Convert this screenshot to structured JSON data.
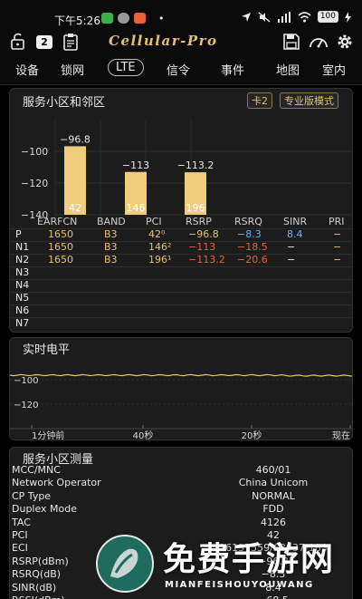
{
  "status_bar": {
    "time": "下午5:26",
    "dot": "•",
    "battery": "100"
  },
  "toolbar": {
    "badge": "2",
    "logo": "Cellular-Pro"
  },
  "tabs": [
    {
      "label": "设备"
    },
    {
      "label": "锁网"
    },
    {
      "label": "LTE"
    },
    {
      "label": "信令"
    },
    {
      "label": "事件"
    },
    {
      "label": "地图"
    },
    {
      "label": "室内"
    }
  ],
  "serving_panel": {
    "title": "服务小区和邻区",
    "card_tag": "卡2",
    "mode_tag": "专业版模式"
  },
  "chart_data": {
    "type": "bar",
    "categories": [
      "42",
      "146",
      "196"
    ],
    "values": [
      -96.8,
      -113,
      -113.2
    ],
    "value_labels": [
      "−96.8",
      "−113",
      "−113.2"
    ],
    "y_ticks": [
      "−100",
      "−120",
      "−140"
    ],
    "ylim": [
      -140,
      -84
    ],
    "bar_color": "#f0cd7a"
  },
  "cell_table": {
    "headers": [
      "EARFCN",
      "BAND",
      "PCI",
      "RSRP",
      "RSRQ",
      "SINR",
      "PRI"
    ],
    "rows": [
      {
        "label": "P",
        "earfcn": "1650",
        "band": "B3",
        "pci": "42⁰",
        "rsrp": "−96.8",
        "rsrq": "−8.3",
        "sinr": "8.4",
        "pri": "−"
      },
      {
        "label": "N1",
        "earfcn": "1650",
        "band": "B3",
        "pci": "146²",
        "rsrp": "−113",
        "rsrq": "−18.5",
        "sinr": "−",
        "pri": "−"
      },
      {
        "label": "N2",
        "earfcn": "1650",
        "band": "B3",
        "pci": "196¹",
        "rsrp": "−113.2",
        "rsrq": "−20.6",
        "sinr": "−",
        "pri": "−"
      },
      {
        "label": "N3"
      },
      {
        "label": "N4"
      },
      {
        "label": "N5"
      },
      {
        "label": "N6"
      },
      {
        "label": "N7"
      }
    ],
    "colors": {
      "white": "#e8e8e8",
      "yellow": "#e4c16f",
      "blue": "#6fb0f0",
      "red": "#e8603a"
    }
  },
  "realtime_panel": {
    "title": "实时电平",
    "y_ticks": [
      "−100",
      "−120"
    ],
    "x_ticks": [
      "1分钟前",
      "40秒",
      "20秒",
      "现在"
    ]
  },
  "measurement_panel": {
    "title": "服务小区测量",
    "rows": [
      {
        "key": "MCC/MNC",
        "value": "460/01"
      },
      {
        "key": "Network Operator",
        "value": "China Unicom"
      },
      {
        "key": "CP Type",
        "value": "NORMAL"
      },
      {
        "key": "Duplex Mode",
        "value": "FDD"
      },
      {
        "key": "TAC",
        "value": "4126"
      },
      {
        "key": "PCI",
        "value": "42"
      },
      {
        "key": "ECI",
        "value": "16137559/63037-183"
      },
      {
        "key": "RSRP(dBm)",
        "value": "−96.8"
      },
      {
        "key": "RSRQ(dB)",
        "value": "−8.3"
      },
      {
        "key": "SINR(dB)",
        "value": "8.4"
      },
      {
        "key": "RSSI(dBm)",
        "value": "−68.5"
      }
    ]
  },
  "watermark": {
    "text": "免费手游网",
    "sub": "MIANFEISHOUYOUWANG"
  }
}
